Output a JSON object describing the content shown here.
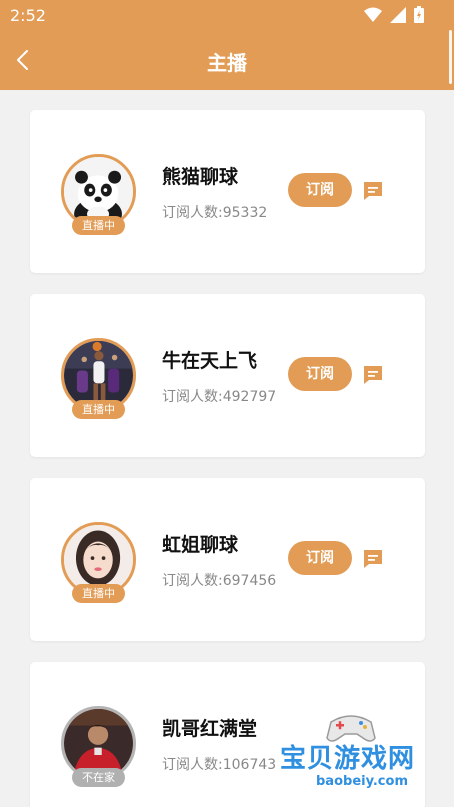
{
  "status_bar": {
    "time": "2:52"
  },
  "header": {
    "title": "主播"
  },
  "subscribe_label": "订阅",
  "anchors": [
    {
      "name": "熊猫聊球",
      "subscribers": "订阅人数:95332",
      "status": "直播中",
      "avatar": "panda-avatar"
    },
    {
      "name": "牛在天上飞",
      "subscribers": "订阅人数:492797",
      "status": "直播中",
      "avatar": "basketball-avatar"
    },
    {
      "name": "虹姐聊球",
      "subscribers": "订阅人数:697456",
      "status": "直播中",
      "avatar": "girl-avatar"
    },
    {
      "name": "凯哥红满堂",
      "subscribers": "订阅人数:106743",
      "status": "不在家",
      "avatar": "football-avatar"
    }
  ],
  "watermark": {
    "text": "宝贝游戏网",
    "url": "baobeiy.com"
  },
  "colors": {
    "accent": "#e39c55",
    "offline": "#b0b0b0"
  }
}
